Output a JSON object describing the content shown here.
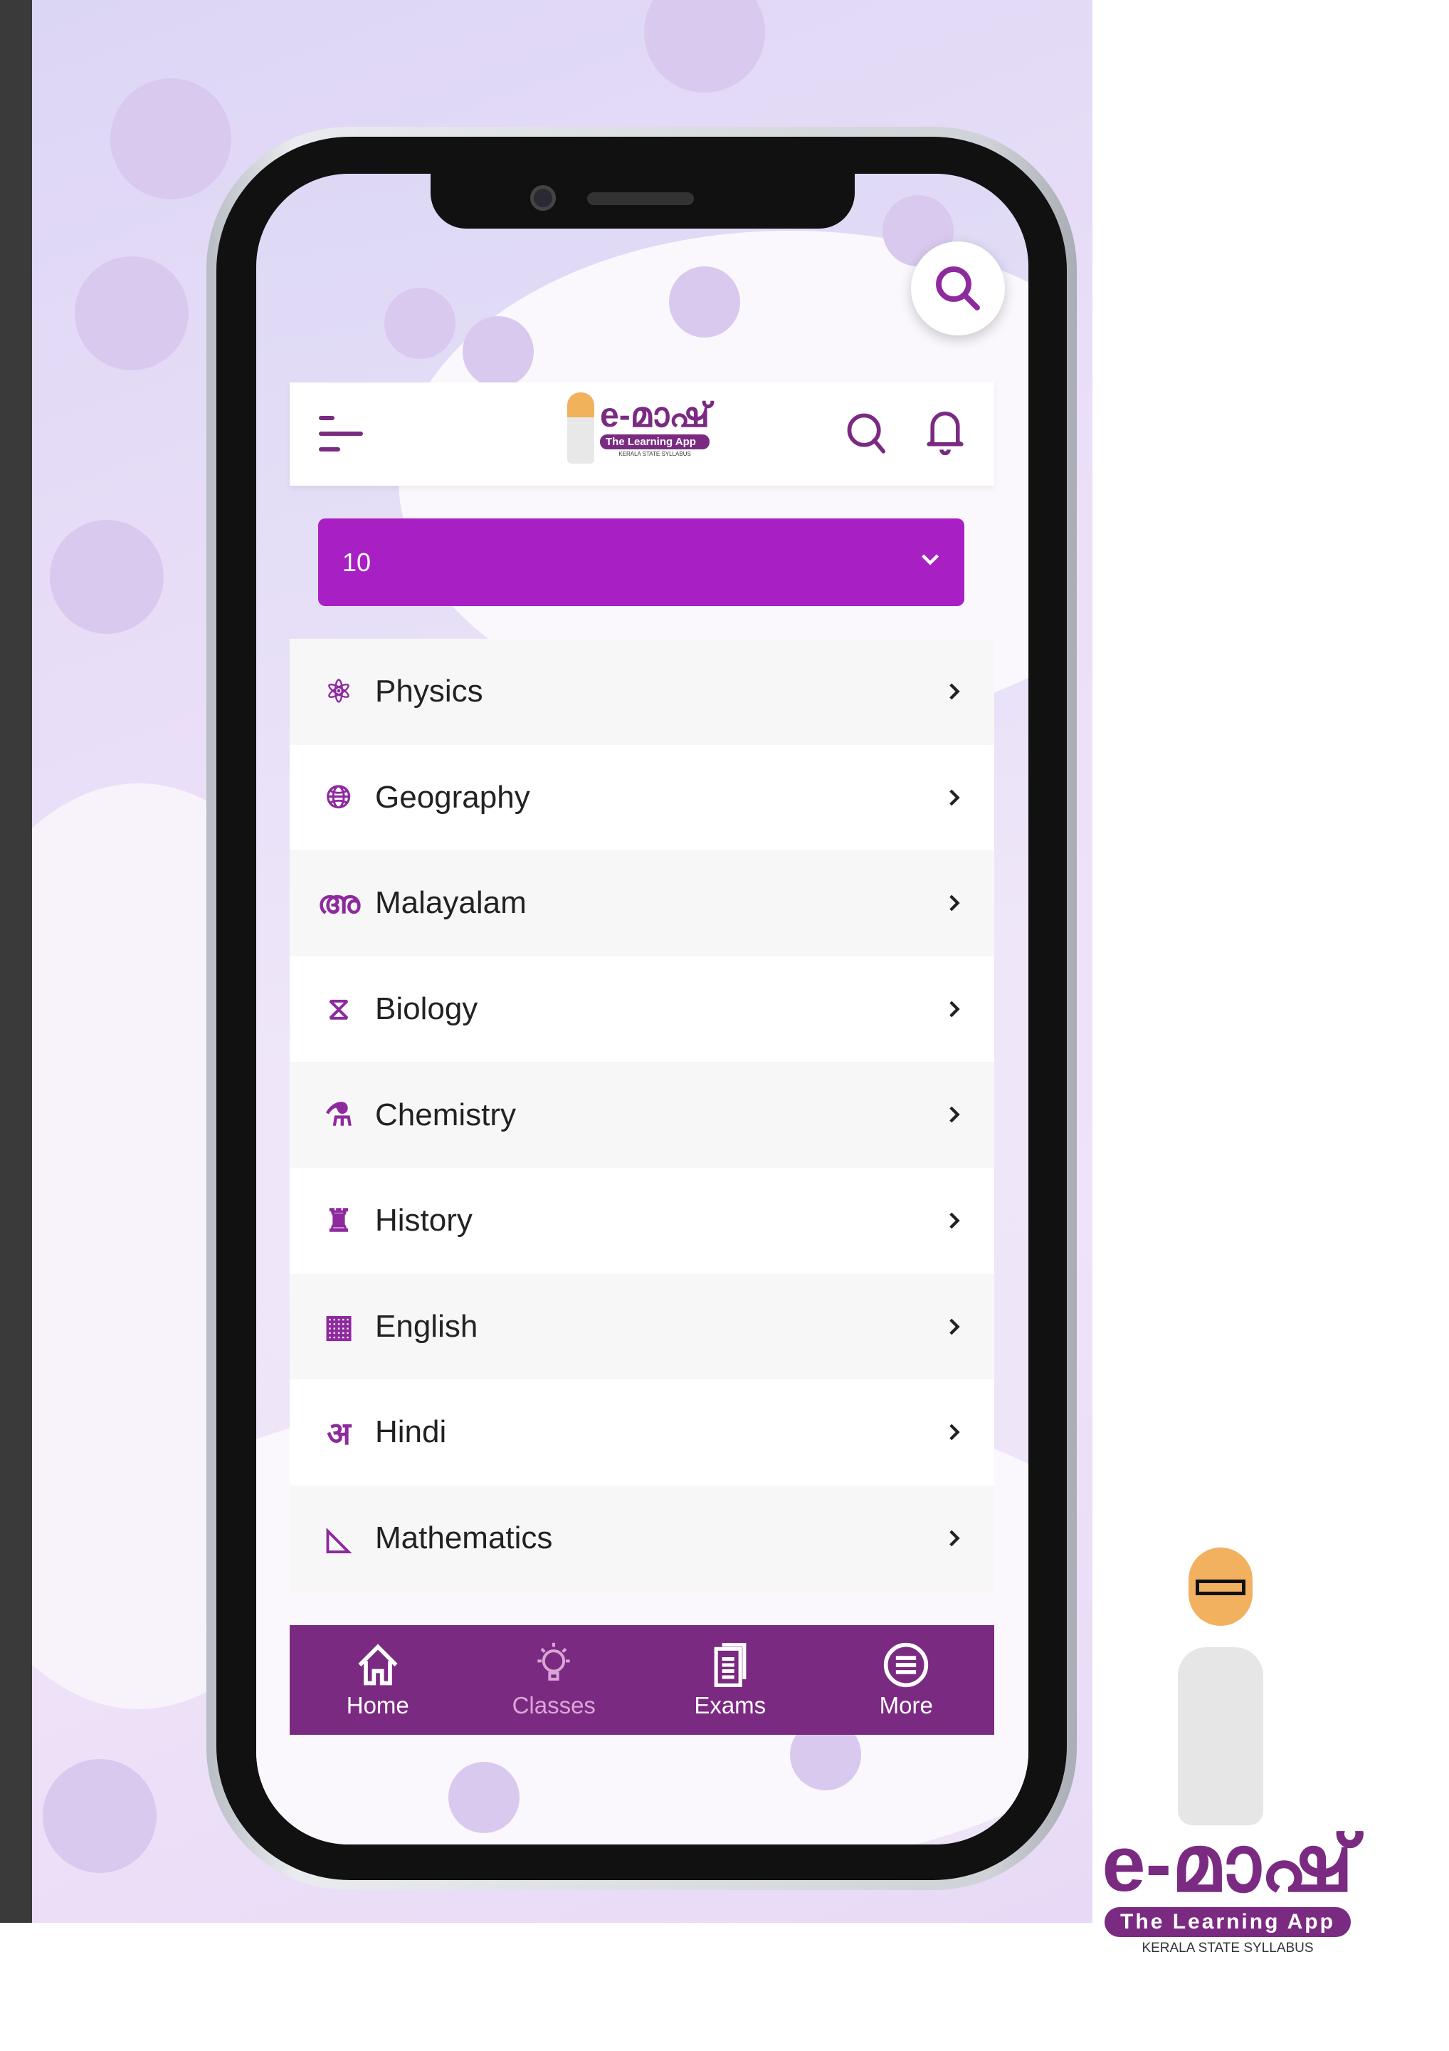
{
  "header": {
    "menu_icon": "menu-icon",
    "logo_text": "e-മാഷ്",
    "logo_tagline": "The Learning App",
    "logo_sub": "KERALA STATE SYLLABUS"
  },
  "class_select": {
    "value": "10"
  },
  "subjects": [
    {
      "label": "Physics",
      "icon": "atom-icon"
    },
    {
      "label": "Geography",
      "icon": "globe-icon"
    },
    {
      "label": "Malayalam",
      "icon": "malayalam-letter-icon"
    },
    {
      "label": "Biology",
      "icon": "dna-icon"
    },
    {
      "label": "Chemistry",
      "icon": "flask-icon"
    },
    {
      "label": "History",
      "icon": "pharaoh-icon"
    },
    {
      "label": "English",
      "icon": "abc-blocks-icon"
    },
    {
      "label": "Hindi",
      "icon": "hindi-letter-icon"
    },
    {
      "label": "Mathematics",
      "icon": "geometry-icon"
    }
  ],
  "nav": [
    {
      "label": "Home"
    },
    {
      "label": "Classes"
    },
    {
      "label": "Exams"
    },
    {
      "label": "More"
    }
  ],
  "brand": {
    "name": "e-മാഷ്",
    "tagline": "The Learning App",
    "sub": "KERALA STATE SYLLABUS"
  },
  "colors": {
    "primary": "#7b2a82",
    "dropdown": "#a81fc4",
    "background": "#ece0f8"
  }
}
